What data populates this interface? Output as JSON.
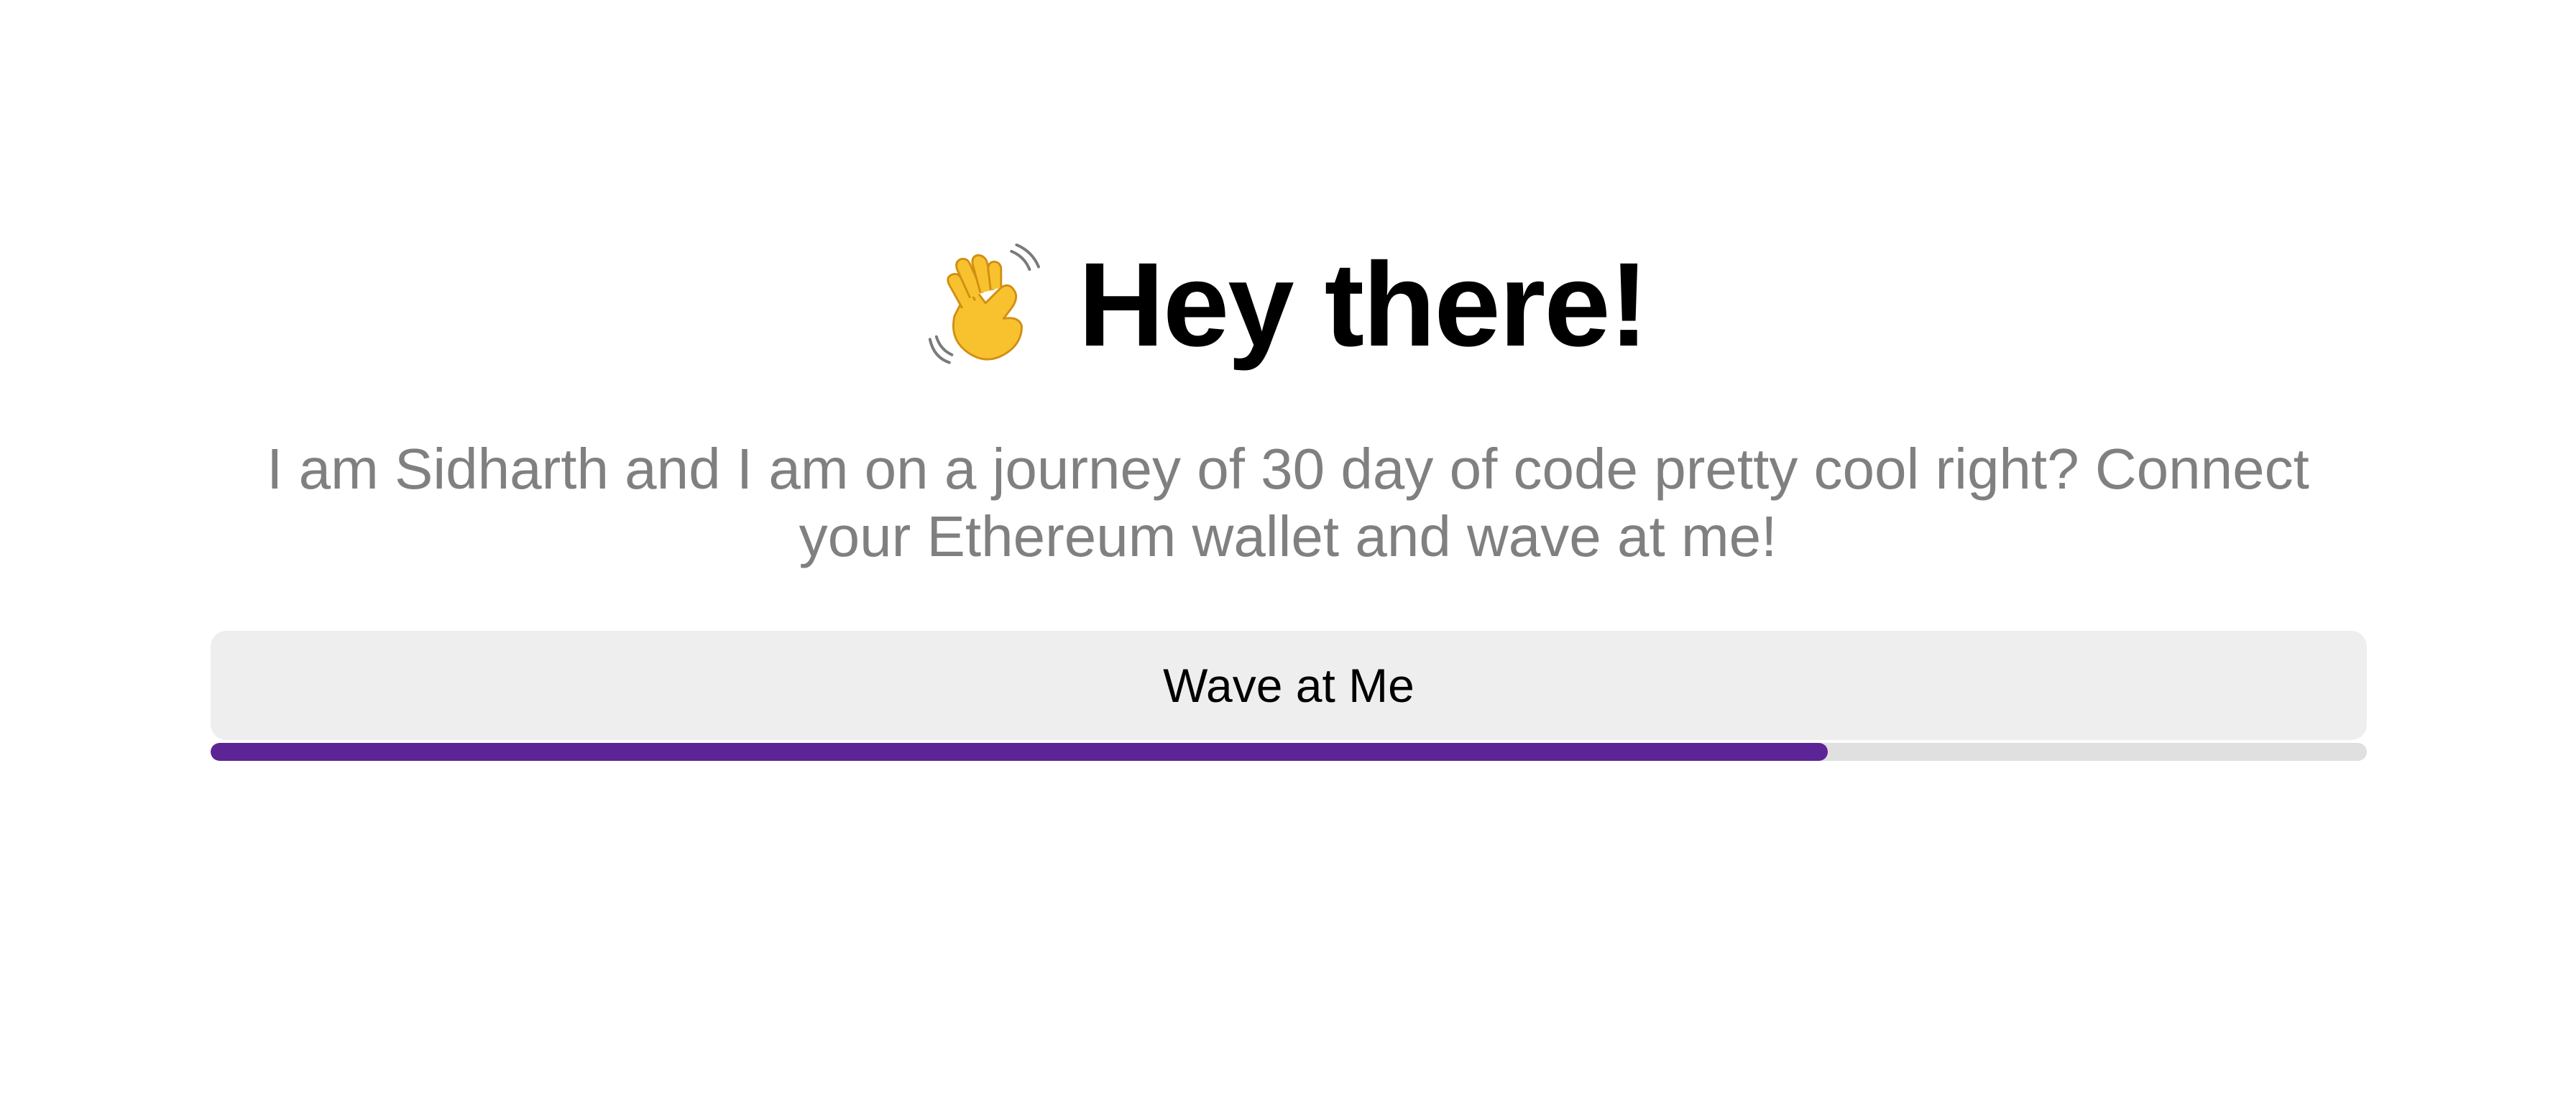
{
  "header": {
    "icon": "waving-hand-icon",
    "title": "Hey there!"
  },
  "bio": {
    "text": "I am Sidharth and I am on a journey of 30 day of code pretty cool right? Connect your Ethereum wallet and wave at me!"
  },
  "wave_button": {
    "label": "Wave at Me"
  },
  "progress": {
    "value_percent": 75
  },
  "colors": {
    "title": "#000000",
    "bio": "#808080",
    "button_bg": "#eeeeee",
    "progress_track": "#e0e0e0",
    "progress_fill": "#5d2495",
    "hand": "#f7c22e"
  }
}
